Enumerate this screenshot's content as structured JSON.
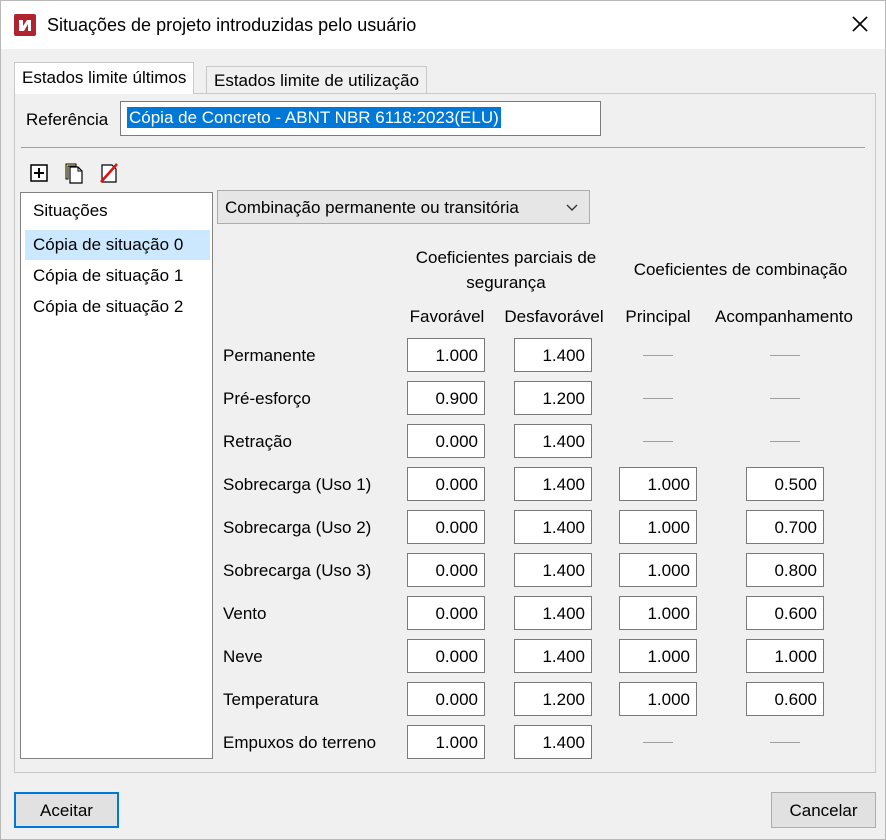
{
  "window": {
    "title": "Situações de projeto introduzidas pelo usuário",
    "close_icon": "close-icon",
    "app_icon": "app-logo-icon"
  },
  "tabs": [
    {
      "label": "Estados limite últimos",
      "active": true
    },
    {
      "label": "Estados limite de utilização",
      "active": false
    }
  ],
  "reference": {
    "label": "Referência",
    "value": "Cópia de Concreto - ABNT NBR 6118:2023(ELU)"
  },
  "toolbar": {
    "icons": [
      "add-icon",
      "copy-icon",
      "delete-icon"
    ]
  },
  "situations": {
    "header": "Situações",
    "items": [
      "Cópia de situação 0",
      "Cópia de situação 1",
      "Cópia de situação 2"
    ],
    "selected_index": 0
  },
  "combination": {
    "selected": "Combinação permanente ou transitória"
  },
  "table": {
    "group_headers": {
      "partial_line1": "Coeficientes parciais de",
      "partial_line2": "segurança",
      "combination": "Coeficientes de combinação"
    },
    "columns": [
      "Favorável",
      "Desfavorável",
      "Principal",
      "Acompanhamento"
    ],
    "rows": [
      {
        "label": "Permanente",
        "favoravel": "1.000",
        "desfavoravel": "1.400",
        "principal": null,
        "acompanhamento": null
      },
      {
        "label": "Pré-esforço",
        "favoravel": "0.900",
        "desfavoravel": "1.200",
        "principal": null,
        "acompanhamento": null
      },
      {
        "label": "Retração",
        "favoravel": "0.000",
        "desfavoravel": "1.400",
        "principal": null,
        "acompanhamento": null
      },
      {
        "label": "Sobrecarga (Uso 1)",
        "favoravel": "0.000",
        "desfavoravel": "1.400",
        "principal": "1.000",
        "acompanhamento": "0.500"
      },
      {
        "label": "Sobrecarga (Uso 2)",
        "favoravel": "0.000",
        "desfavoravel": "1.400",
        "principal": "1.000",
        "acompanhamento": "0.700"
      },
      {
        "label": "Sobrecarga (Uso 3)",
        "favoravel": "0.000",
        "desfavoravel": "1.400",
        "principal": "1.000",
        "acompanhamento": "0.800"
      },
      {
        "label": "Vento",
        "favoravel": "0.000",
        "desfavoravel": "1.400",
        "principal": "1.000",
        "acompanhamento": "0.600"
      },
      {
        "label": "Neve",
        "favoravel": "0.000",
        "desfavoravel": "1.400",
        "principal": "1.000",
        "acompanhamento": "1.000"
      },
      {
        "label": "Temperatura",
        "favoravel": "0.000",
        "desfavoravel": "1.200",
        "principal": "1.000",
        "acompanhamento": "0.600"
      },
      {
        "label": "Empuxos do terreno",
        "favoravel": "1.000",
        "desfavoravel": "1.400",
        "principal": null,
        "acompanhamento": null
      }
    ]
  },
  "buttons": {
    "accept": "Aceitar",
    "cancel": "Cancelar"
  },
  "colors": {
    "selection": "#0078d7",
    "list_selected": "#cce8ff",
    "app_icon": "#b3232f",
    "delete_red": "#e01010"
  }
}
